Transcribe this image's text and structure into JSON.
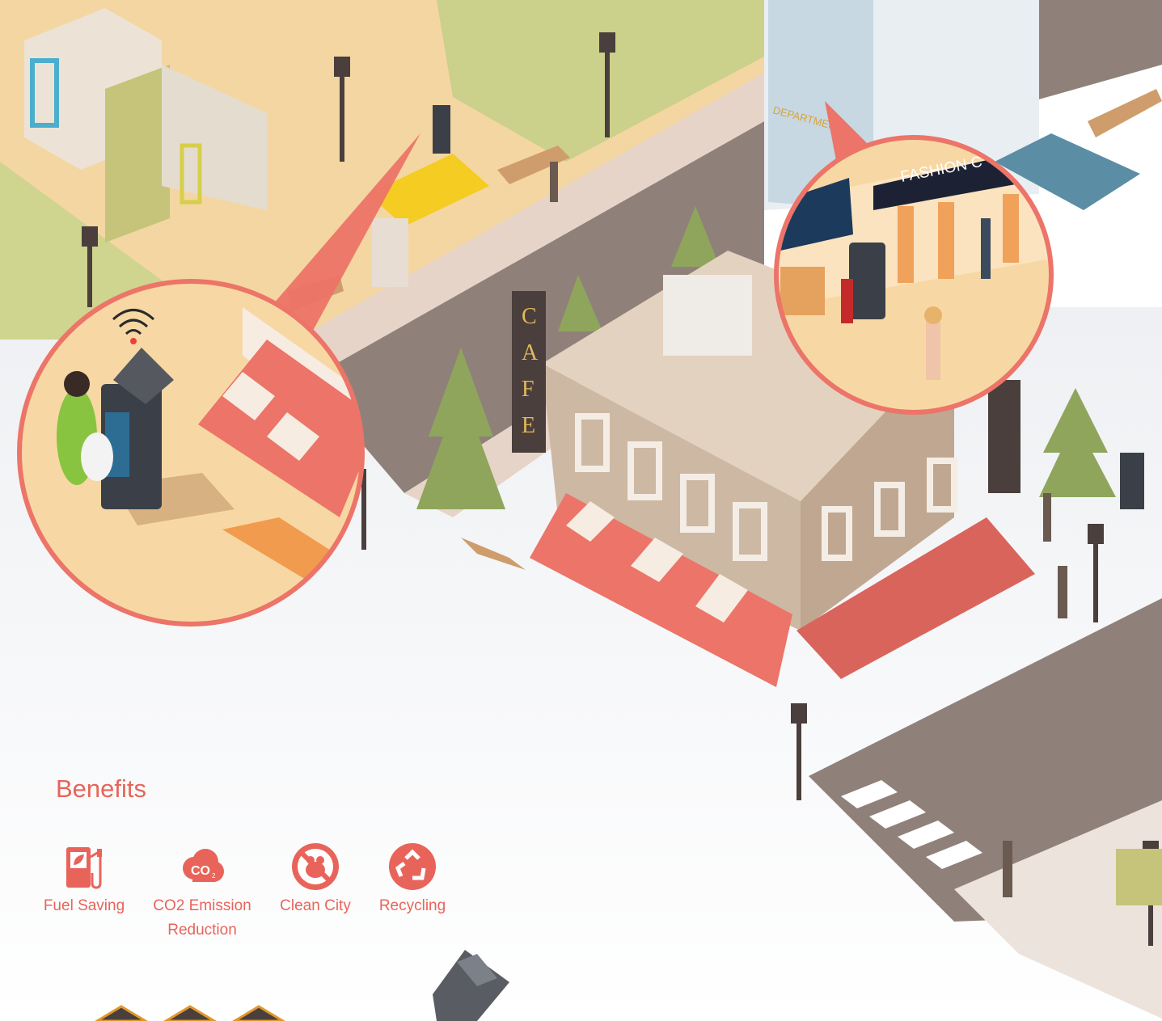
{
  "scene": {
    "store_sign": "FASHION C",
    "department_sign": "DEPARTMENT",
    "cafe_sign_letters": [
      "C",
      "A",
      "F",
      "E"
    ],
    "colors": {
      "accent": "#e8645a",
      "sand": "#f6d69f",
      "grass": "#cdd48a",
      "road": "#8d7f76",
      "sidewalk": "#e9d7cb",
      "building": "#c9b39f",
      "awning_red": "#ec7468"
    }
  },
  "benefits": {
    "title": "Benefits",
    "items": [
      {
        "label_line1": "Fuel Saving",
        "label_line2": "",
        "icon": "fuel-pump-icon"
      },
      {
        "label_line1": "CO2 Emission",
        "label_line2": "Reduction",
        "icon": "co2-cloud-icon"
      },
      {
        "label_line1": "Clean City",
        "label_line2": "",
        "icon": "no-rats-icon"
      },
      {
        "label_line1": "Recycling",
        "label_line2": "",
        "icon": "recycle-icon"
      }
    ]
  }
}
